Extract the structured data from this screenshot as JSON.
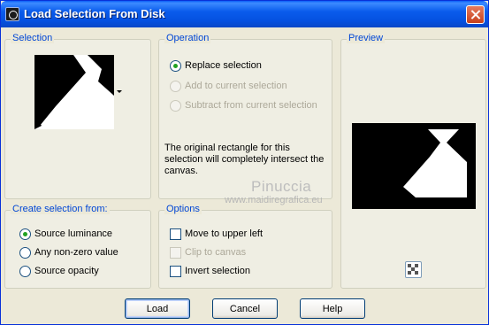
{
  "window": {
    "title": "Load Selection From Disk"
  },
  "selection": {
    "label": "Selection"
  },
  "operation": {
    "label": "Operation",
    "options": [
      {
        "text": "Replace selection",
        "checked": true,
        "disabled": false
      },
      {
        "text": "Add to current selection",
        "checked": false,
        "disabled": true
      },
      {
        "text": "Subtract from current selection",
        "checked": false,
        "disabled": true
      }
    ],
    "description": "The original rectangle for this\nselection will completely intersect the\ncanvas."
  },
  "preview": {
    "label": "Preview",
    "checker_icon": "checkerboard-icon"
  },
  "create_from": {
    "label": "Create selection from:",
    "options": [
      {
        "text": "Source luminance",
        "checked": true
      },
      {
        "text": "Any non-zero value",
        "checked": false
      },
      {
        "text": "Source opacity",
        "checked": false
      }
    ]
  },
  "options": {
    "label": "Options",
    "items": [
      {
        "text": "Move to upper left",
        "checked": false,
        "disabled": false
      },
      {
        "text": "Clip to canvas",
        "checked": false,
        "disabled": true
      },
      {
        "text": "Invert selection",
        "checked": false,
        "disabled": false
      }
    ]
  },
  "watermark": {
    "name": "Pinuccia",
    "url": "www.maidiregrafica.eu"
  },
  "buttons": {
    "load": "Load",
    "cancel": "Cancel",
    "help": "Help"
  },
  "colors": {
    "title_bar": "#0a5cec",
    "group_label": "#0046d5",
    "radio_checked": "#21a121"
  }
}
